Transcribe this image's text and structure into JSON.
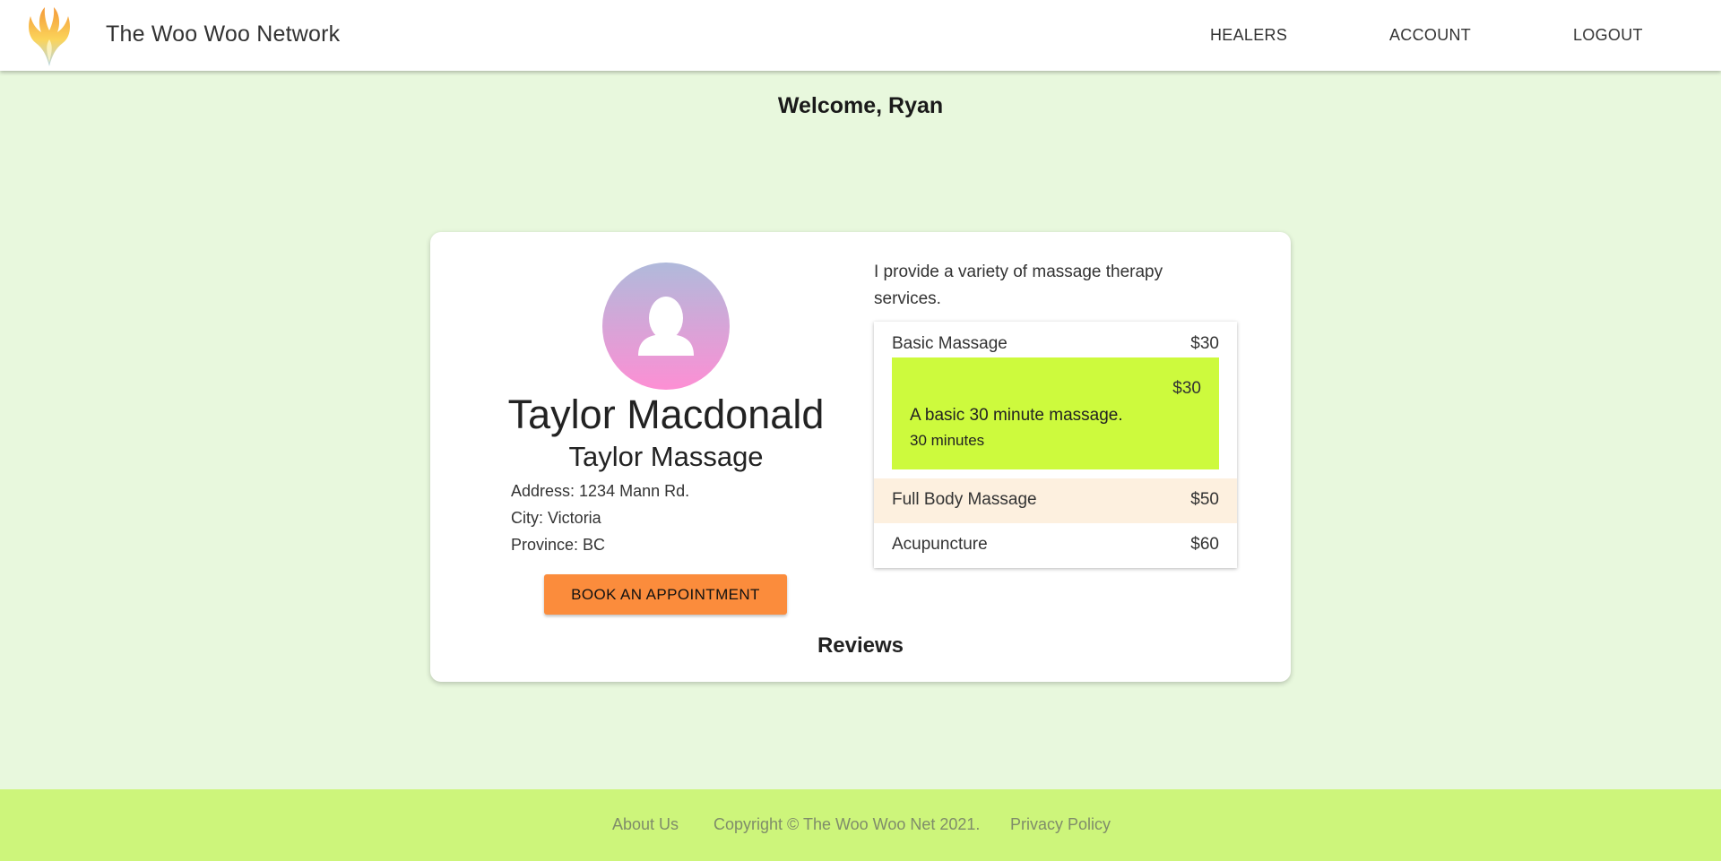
{
  "header": {
    "logo_icon": "phoenix-logo-icon",
    "brand": "The Woo Woo Network",
    "nav": {
      "healers": "HEALERS",
      "account": "ACCOUNT",
      "logout": "LOGOUT"
    }
  },
  "welcome": "Welcome, Ryan",
  "profile": {
    "avatar_icon": "user-avatar-icon",
    "name": "Taylor Macdonald",
    "business": "Taylor Massage",
    "address": "Address: 1234 Mann Rd.",
    "city": "City: Victoria",
    "province": "Province: BC",
    "book_button": "BOOK AN APPOINTMENT",
    "reviews_heading": "Reviews",
    "description": "I provide a variety of massage therapy services."
  },
  "services": {
    "items": [
      {
        "name": "Basic Massage",
        "price": "$30"
      },
      {
        "name": "Full Body Massage",
        "price": "$50"
      },
      {
        "name": "Acupuncture",
        "price": "$60"
      }
    ],
    "expanded": {
      "price": "$30",
      "description": "A basic 30 minute massage.",
      "duration": "30 minutes"
    }
  },
  "footer": {
    "about": "About Us",
    "copyright": "Copyright © The Woo Woo Net 2021.",
    "privacy": "Privacy Policy"
  },
  "colors": {
    "page_bg": "#e8f8dd",
    "footer_bg": "#cdf57b",
    "button": "#fb8c3c",
    "expanded_bg": "#cdfa3d",
    "hover_row": "#fdf0df"
  }
}
